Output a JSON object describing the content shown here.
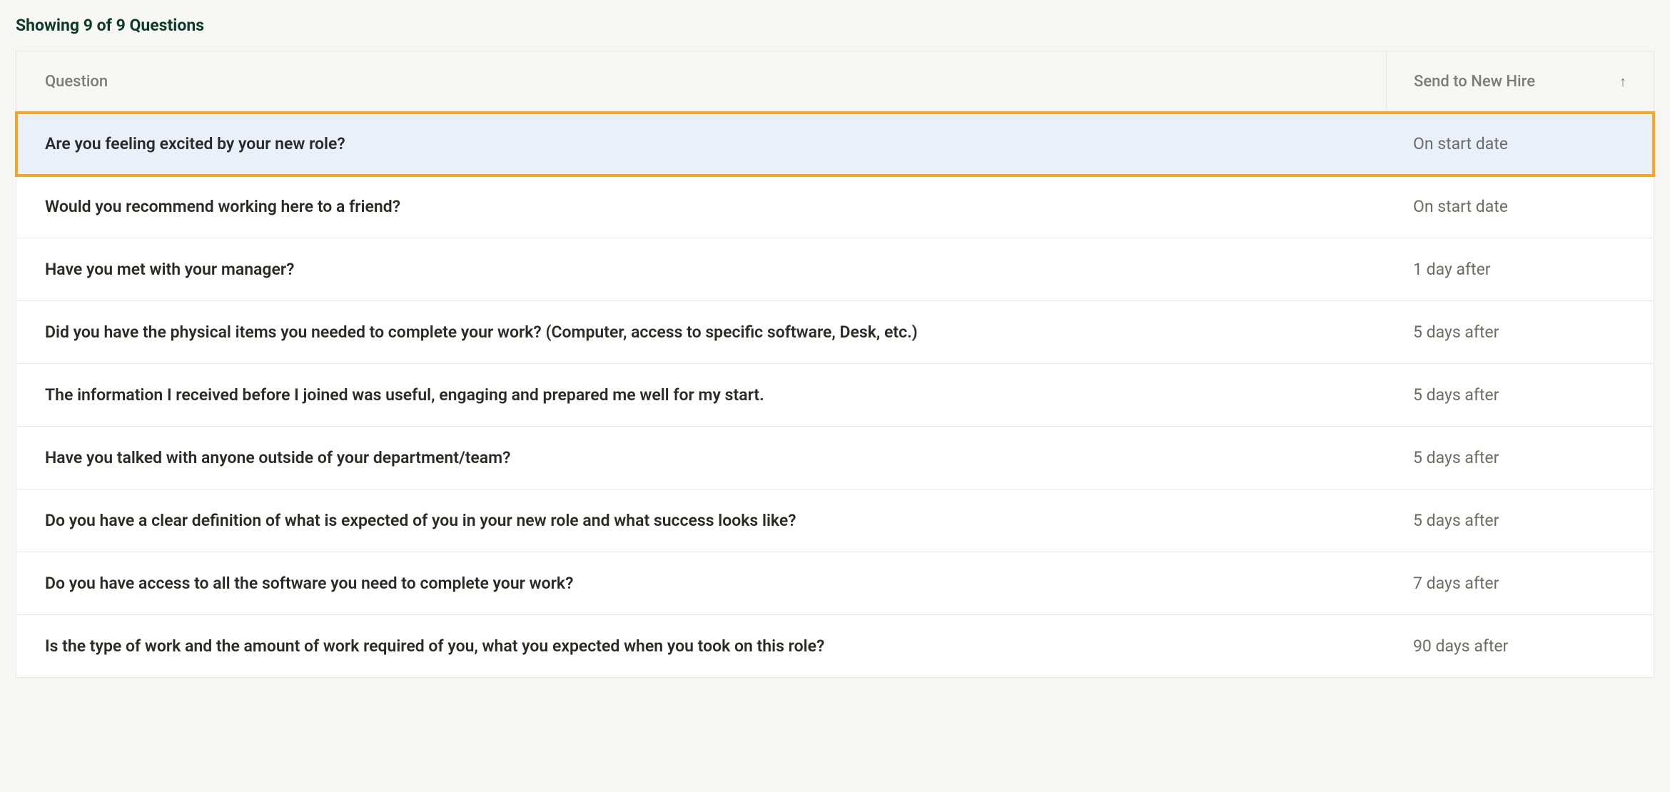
{
  "counter_text": "Showing 9 of 9 Questions",
  "columns": {
    "question": "Question",
    "schedule": "Send to New Hire",
    "sort_icon": "↑"
  },
  "rows": [
    {
      "question": "Are you feeling excited by your new role?",
      "schedule": "On start date",
      "highlighted": true
    },
    {
      "question": "Would you recommend working here to a friend?",
      "schedule": "On start date",
      "highlighted": false
    },
    {
      "question": "Have you met with your manager?",
      "schedule": "1 day after",
      "highlighted": false
    },
    {
      "question": "Did you have the physical items you needed to complete your work? (Computer, access to specific software, Desk, etc.)",
      "schedule": "5 days after",
      "highlighted": false
    },
    {
      "question": "The information I received before I joined was useful, engaging and prepared me well for my start.",
      "schedule": "5 days after",
      "highlighted": false
    },
    {
      "question": "Have you talked with anyone outside of your department/team?",
      "schedule": "5 days after",
      "highlighted": false
    },
    {
      "question": "Do you have a clear definition of what is expected of you in your new role and what success looks like?",
      "schedule": "5 days after",
      "highlighted": false
    },
    {
      "question": "Do you have access to all the software you need to complete your work?",
      "schedule": "7 days after",
      "highlighted": false
    },
    {
      "question": "Is the type of work and the amount of work required of you, what you expected when you took on this role?",
      "schedule": "90 days after",
      "highlighted": false
    }
  ]
}
